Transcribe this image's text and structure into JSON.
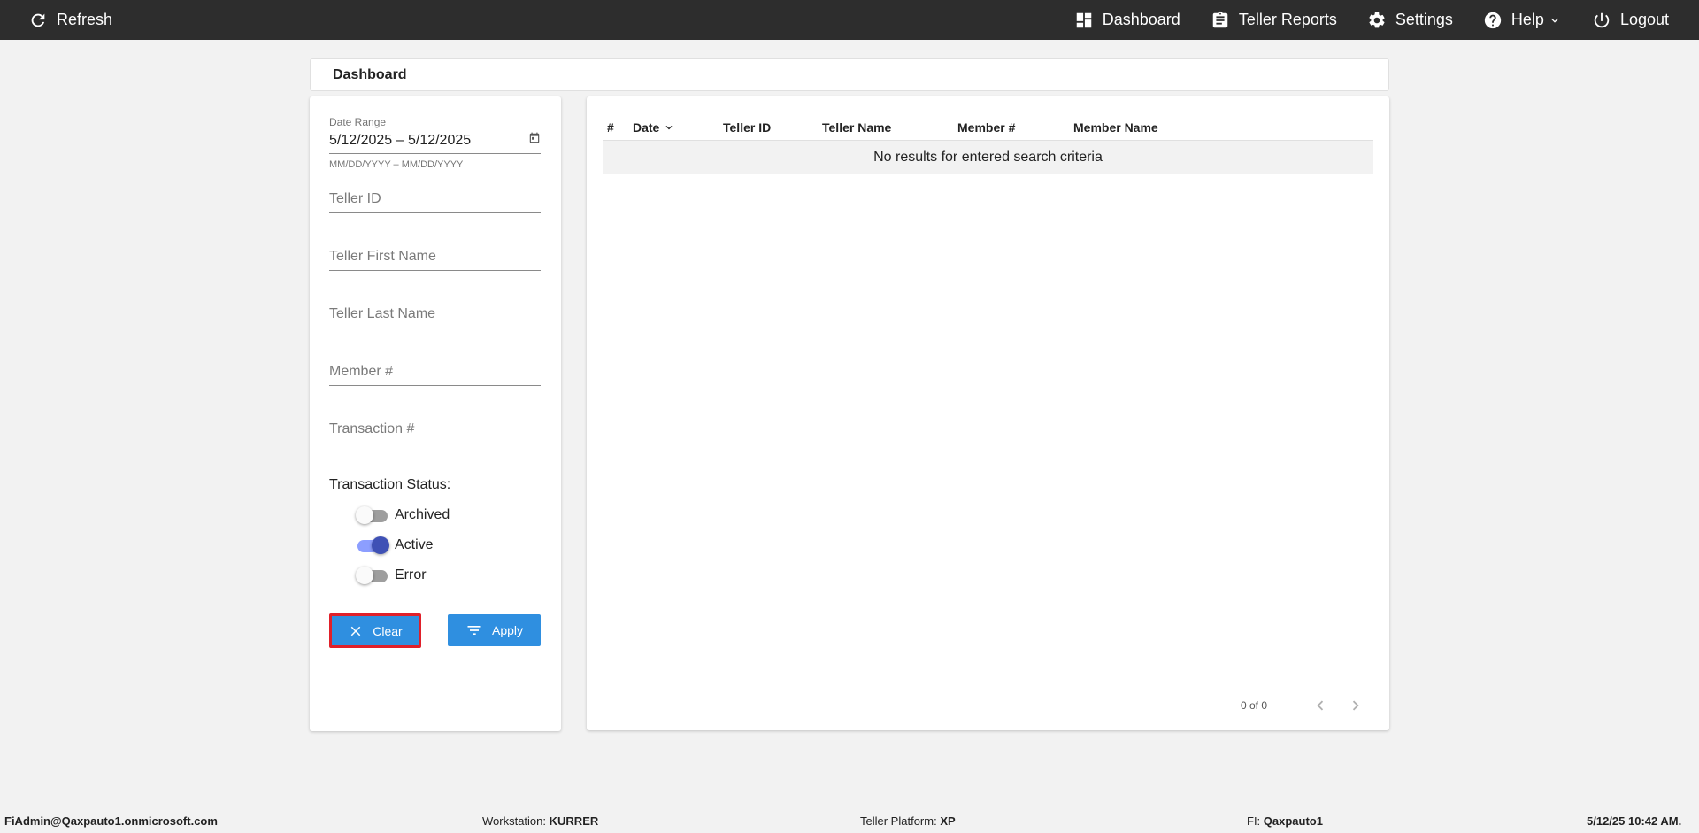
{
  "topbar": {
    "refresh_label": "Refresh",
    "nav": [
      {
        "label": "Dashboard",
        "icon": "dashboard-icon"
      },
      {
        "label": "Teller Reports",
        "icon": "clipboard-icon"
      },
      {
        "label": "Settings",
        "icon": "gear-icon"
      },
      {
        "label": "Help",
        "icon": "help-icon"
      },
      {
        "label": "Logout",
        "icon": "power-icon"
      }
    ]
  },
  "page_title": "Dashboard",
  "filters": {
    "date_range": {
      "label": "Date Range",
      "value": "5/12/2025 – 5/12/2025",
      "hint": "MM/DD/YYYY – MM/DD/YYYY"
    },
    "teller_id_placeholder": "Teller ID",
    "teller_first_name_placeholder": "Teller First Name",
    "teller_last_name_placeholder": "Teller Last Name",
    "member_number_placeholder": "Member #",
    "transaction_number_placeholder": "Transaction #",
    "status_title": "Transaction Status:",
    "statuses": [
      {
        "label": "Archived",
        "on": false
      },
      {
        "label": "Active",
        "on": true
      },
      {
        "label": "Error",
        "on": false
      }
    ],
    "clear_label": "Clear",
    "apply_label": "Apply"
  },
  "table": {
    "columns": [
      "#",
      "Date",
      "Teller ID",
      "Teller Name",
      "Member #",
      "Member Name"
    ],
    "empty_message": "No results for entered search criteria",
    "pager_text": "0 of 0"
  },
  "footer": {
    "user": "FiAdmin@Qaxpauto1.onmicrosoft.com",
    "workstation_label": "Workstation:",
    "workstation_value": "KURRER",
    "platform_label": "Teller Platform:",
    "platform_value": "XP",
    "fi_label": "FI:",
    "fi_value": "Qaxpauto1",
    "datetime": "5/12/25 10:42 AM."
  },
  "colors": {
    "topbar": "#2d2d2d",
    "button": "#2f8fe0",
    "toggle_on": "#3f51b5",
    "focus_border": "#e0202a"
  }
}
